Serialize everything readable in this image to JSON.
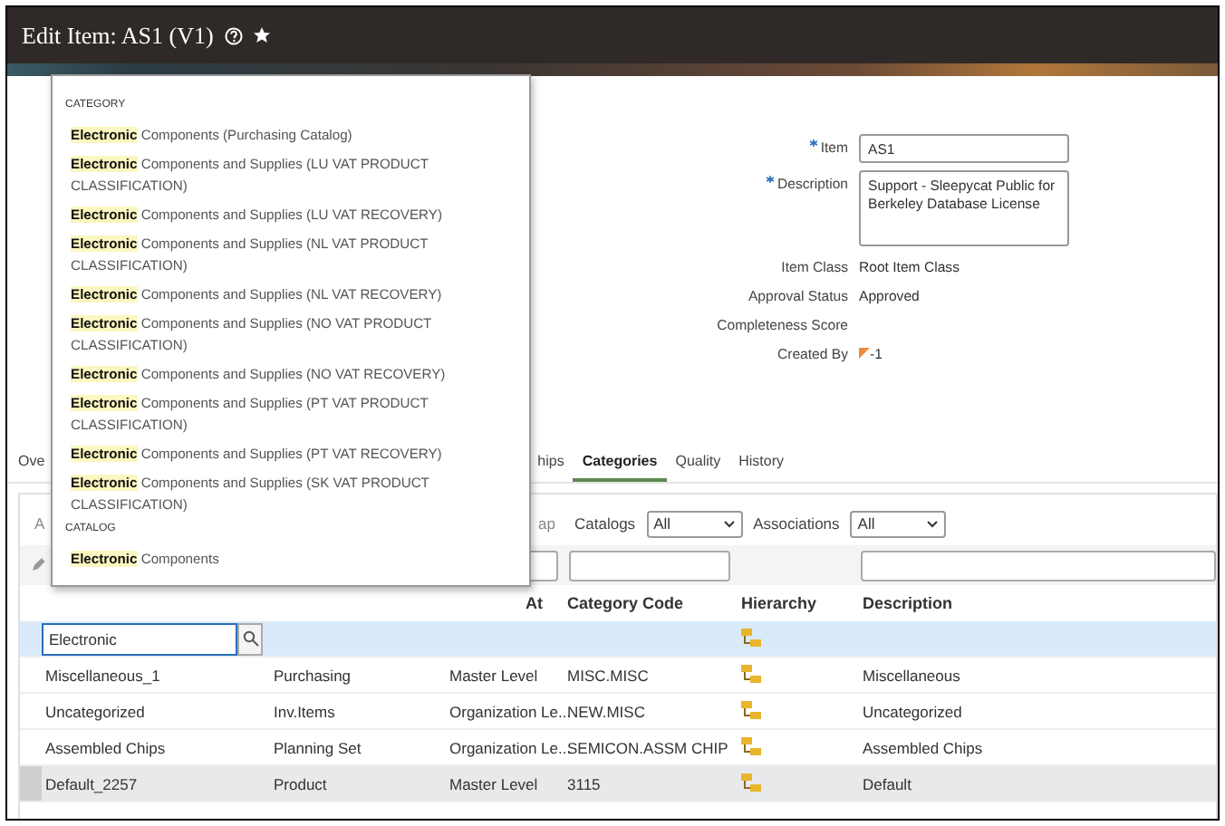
{
  "header": {
    "title": "Edit Item: AS1 (V1)",
    "favorite": true
  },
  "form": [
    {
      "kind": "input",
      "label": "Item",
      "required": true,
      "value": "AS1"
    },
    {
      "kind": "textarea",
      "label": "Description",
      "required": true,
      "value": "Support - Sleepycat Public for Berkeley Database License"
    },
    {
      "kind": "text",
      "label": "Item Class",
      "required": false,
      "value": "Root Item Class"
    },
    {
      "kind": "text",
      "label": "Approval Status",
      "required": false,
      "value": "Approved"
    },
    {
      "kind": "text",
      "label": "Completeness Score",
      "required": false
    },
    {
      "kind": "person",
      "label": "Created By",
      "required": false,
      "value": "-1"
    }
  ],
  "tabs": [
    {
      "label": "Ove",
      "selected": false
    },
    {
      "label": "hips",
      "selected": false
    },
    {
      "label": "Categories",
      "selected": true
    },
    {
      "label": "Quality",
      "selected": false
    },
    {
      "label": "History",
      "selected": false
    }
  ],
  "toolbar": {
    "fragments": [
      "A",
      "ap"
    ],
    "filters": [
      {
        "label": "Catalogs",
        "value": "All"
      },
      {
        "label": "Associations",
        "value": "All"
      }
    ]
  },
  "table": {
    "columns": [
      "",
      "",
      "At",
      "Category Code",
      "Hierarchy",
      "Description"
    ],
    "new_row": {
      "value": "Electronic"
    },
    "rows": [
      {
        "selected": false,
        "cells": [
          "Miscellaneous_1",
          "Purchasing",
          "Master Level",
          "MISC.MISC",
          "",
          "Miscellaneous"
        ]
      },
      {
        "selected": false,
        "cells": [
          "Uncategorized",
          "Inv.Items",
          "Organization Le...",
          "NEW.MISC",
          "",
          "Uncategorized"
        ]
      },
      {
        "selected": false,
        "cells": [
          "Assembled Chips",
          "Planning Set",
          "Organization Le...",
          "SEMICON.ASSM CHIP",
          "",
          "Assembled Chips"
        ]
      },
      {
        "selected": true,
        "cells": [
          "Default_2257",
          "Product",
          "Master Level",
          "3115",
          "",
          "Default"
        ]
      }
    ]
  },
  "dropdown": {
    "sections": [
      {
        "heading": "CATEGORY",
        "items": [
          "**Electronic** Components (Purchasing Catalog)",
          "**Electronic** Components and Supplies (LU VAT PRODUCT CLASSIFICATION)",
          "**Electronic** Components and Supplies (LU VAT RECOVERY)",
          "**Electronic** Components and Supplies (NL VAT PRODUCT CLASSIFICATION)",
          "**Electronic** Components and Supplies (NL VAT RECOVERY)",
          "**Electronic** Components and Supplies (NO VAT PRODUCT CLASSIFICATION)",
          "**Electronic** Components and Supplies (NO VAT RECOVERY)",
          "**Electronic** Components and Supplies (PT VAT PRODUCT CLASSIFICATION)",
          "**Electronic** Components and Supplies (PT VAT RECOVERY)",
          "**Electronic** Components and Supplies (SK VAT PRODUCT CLASSIFICATION)"
        ]
      },
      {
        "heading": "CATALOG",
        "items": [
          "**Electronic** Components"
        ]
      }
    ]
  }
}
